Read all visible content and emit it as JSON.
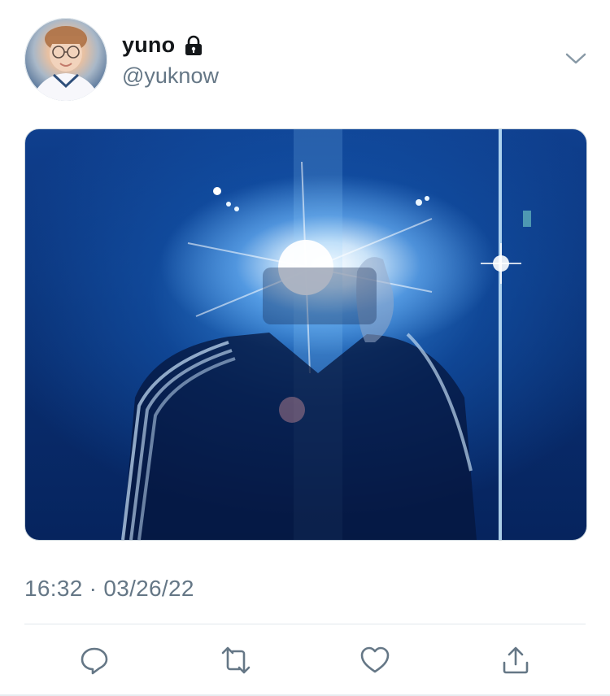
{
  "author": {
    "display_name": "yuno",
    "handle": "@yuknow",
    "verified_icon": "lock-icon"
  },
  "tweet": {
    "timestamp": "16:32 · 03/26/22"
  },
  "actions": {
    "reply_icon": "reply-icon",
    "retweet_icon": "retweet-icon",
    "like_icon": "like-icon",
    "share_icon": "share-icon"
  },
  "colors": {
    "text_primary": "#14171a",
    "text_secondary": "#657786",
    "divider": "#e1e8ed",
    "photo_blue": "#0a2f72"
  }
}
